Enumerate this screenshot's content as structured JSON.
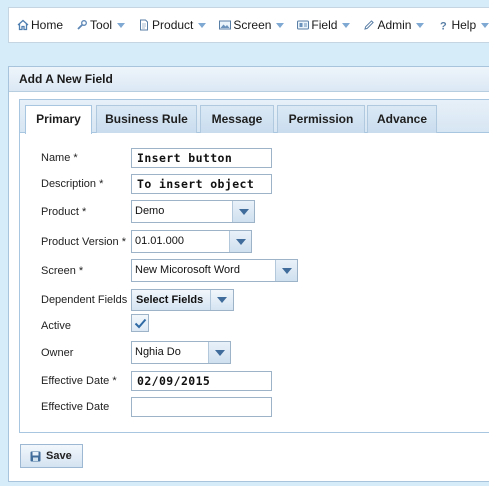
{
  "menu": {
    "items": [
      {
        "label": "Home",
        "icon": "home-icon",
        "dropdown": false
      },
      {
        "label": "Tool",
        "icon": "wrench-icon",
        "dropdown": true
      },
      {
        "label": "Product",
        "icon": "document-icon",
        "dropdown": true
      },
      {
        "label": "Screen",
        "icon": "image-icon",
        "dropdown": true
      },
      {
        "label": "Field",
        "icon": "field-icon",
        "dropdown": true
      },
      {
        "label": "Admin",
        "icon": "pencil-icon",
        "dropdown": true
      },
      {
        "label": "Help",
        "icon": "question-icon",
        "dropdown": true
      }
    ]
  },
  "panel": {
    "title": "Add A New Field"
  },
  "tabs": [
    {
      "label": "Primary",
      "active": true
    },
    {
      "label": "Business Rule",
      "active": false
    },
    {
      "label": "Message",
      "active": false
    },
    {
      "label": "Permission",
      "active": false
    },
    {
      "label": "Advance",
      "active": false
    }
  ],
  "form": {
    "name": {
      "label": "Name *",
      "value": "Insert button"
    },
    "description": {
      "label": "Description *",
      "value": "To insert object"
    },
    "product": {
      "label": "Product *",
      "value": "Demo"
    },
    "product_version": {
      "label": "Product Version *",
      "value": "01.01.000"
    },
    "screen": {
      "label": "Screen *",
      "value": "New Micorosoft Word"
    },
    "dependent_fields": {
      "label": "Dependent Fields",
      "value": "Select Fields"
    },
    "active": {
      "label": "Active",
      "checked": true
    },
    "owner": {
      "label": "Owner",
      "value": "Nghia Do"
    },
    "effective_date_start": {
      "label": "Effective Date *",
      "value": "02/09/2015"
    },
    "effective_date_end": {
      "label": "Effective Date",
      "value": ""
    }
  },
  "actions": {
    "save_label": "Save"
  },
  "colors": {
    "background": "#d6ecf8",
    "accent": "#3f6c9b",
    "border": "#a9c6e0"
  }
}
